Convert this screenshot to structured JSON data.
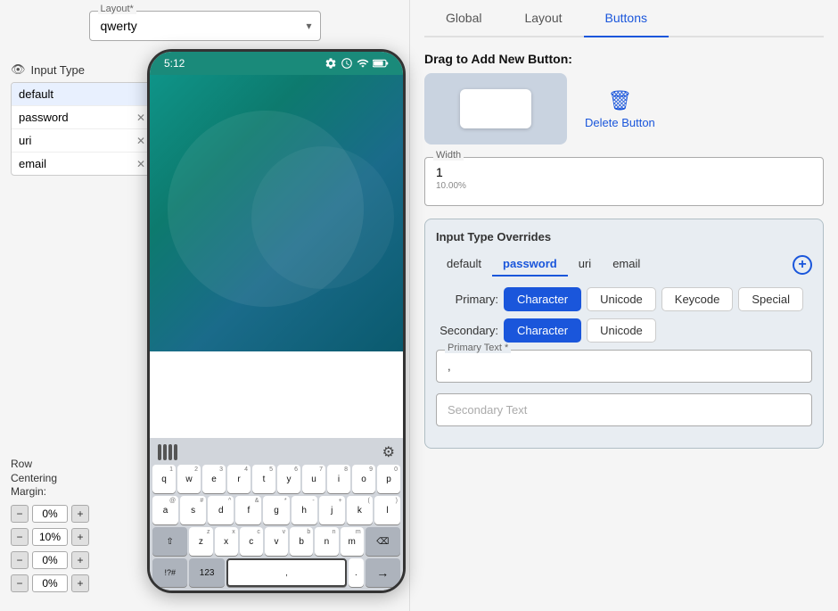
{
  "left": {
    "layout_label": "Layout*",
    "layout_value": "qwerty",
    "layout_arrow": "▾",
    "input_type_header": "Input Type",
    "input_types": [
      {
        "label": "default",
        "removable": false
      },
      {
        "label": "password",
        "removable": true
      },
      {
        "label": "uri",
        "removable": true
      },
      {
        "label": "email",
        "removable": true
      }
    ],
    "phone_time": "5:12",
    "keyboard_rows": [
      [
        "q",
        "w",
        "e",
        "r",
        "t",
        "y",
        "u",
        "i",
        "o",
        "p"
      ],
      [
        "a",
        "s",
        "d",
        "f",
        "g",
        "h",
        "j",
        "k",
        "l"
      ],
      [
        "z",
        "x",
        "c",
        "v",
        "b",
        "n",
        "m"
      ]
    ],
    "row_centering_label": "Row\nCentering\nMargin:",
    "margin_rows": [
      {
        "value": "0%"
      },
      {
        "value": "10%"
      },
      {
        "value": "0%"
      },
      {
        "value": "0%"
      }
    ]
  },
  "right": {
    "tabs": [
      {
        "label": "Global",
        "active": false
      },
      {
        "label": "Layout",
        "active": false
      },
      {
        "label": "Buttons",
        "active": true
      }
    ],
    "drag_label": "Drag to Add New Button:",
    "delete_label": "Delete Button",
    "width_label": "Width",
    "width_value": "1",
    "width_subtext": "10.00%",
    "overrides_title": "Input Type Overrides",
    "overrides_tabs": [
      {
        "label": "default",
        "active": false
      },
      {
        "label": "password",
        "active": true
      },
      {
        "label": "uri",
        "active": false
      },
      {
        "label": "email",
        "active": false
      }
    ],
    "primary_label": "Primary:",
    "secondary_label": "Secondary:",
    "btn_types": [
      "Character",
      "Unicode",
      "Keycode",
      "Special"
    ],
    "primary_active": "Character",
    "secondary_active": "Character",
    "primary_text_label": "Primary Text *",
    "primary_text_value": ",",
    "secondary_text_placeholder": "Secondary Text"
  }
}
